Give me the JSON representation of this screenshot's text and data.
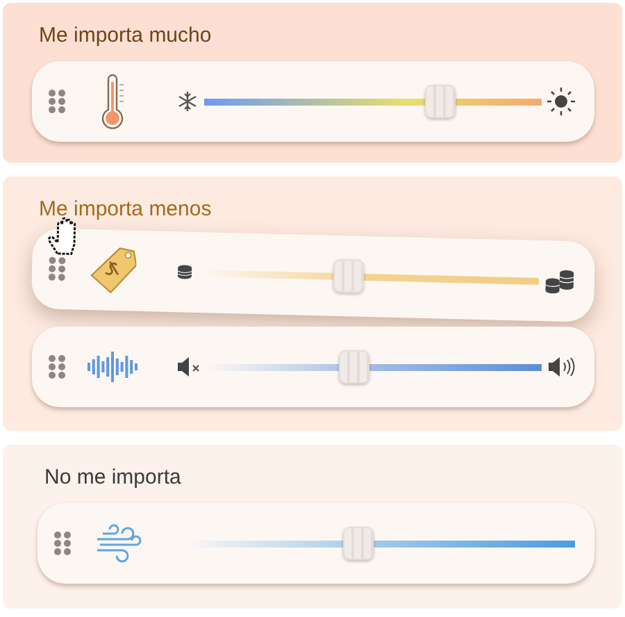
{
  "groups": [
    {
      "title": "Me importa mucho",
      "items": [
        {
          "kind": "temperature",
          "level": 0.7,
          "dragging": false
        }
      ]
    },
    {
      "title": "Me importa menos",
      "items": [
        {
          "kind": "price",
          "level": 0.44,
          "dragging": true
        },
        {
          "kind": "volume",
          "level": 0.44,
          "dragging": false
        }
      ]
    },
    {
      "title": "No me importa",
      "items": [
        {
          "kind": "wind",
          "level": 0.45,
          "dragging": false
        }
      ]
    }
  ]
}
